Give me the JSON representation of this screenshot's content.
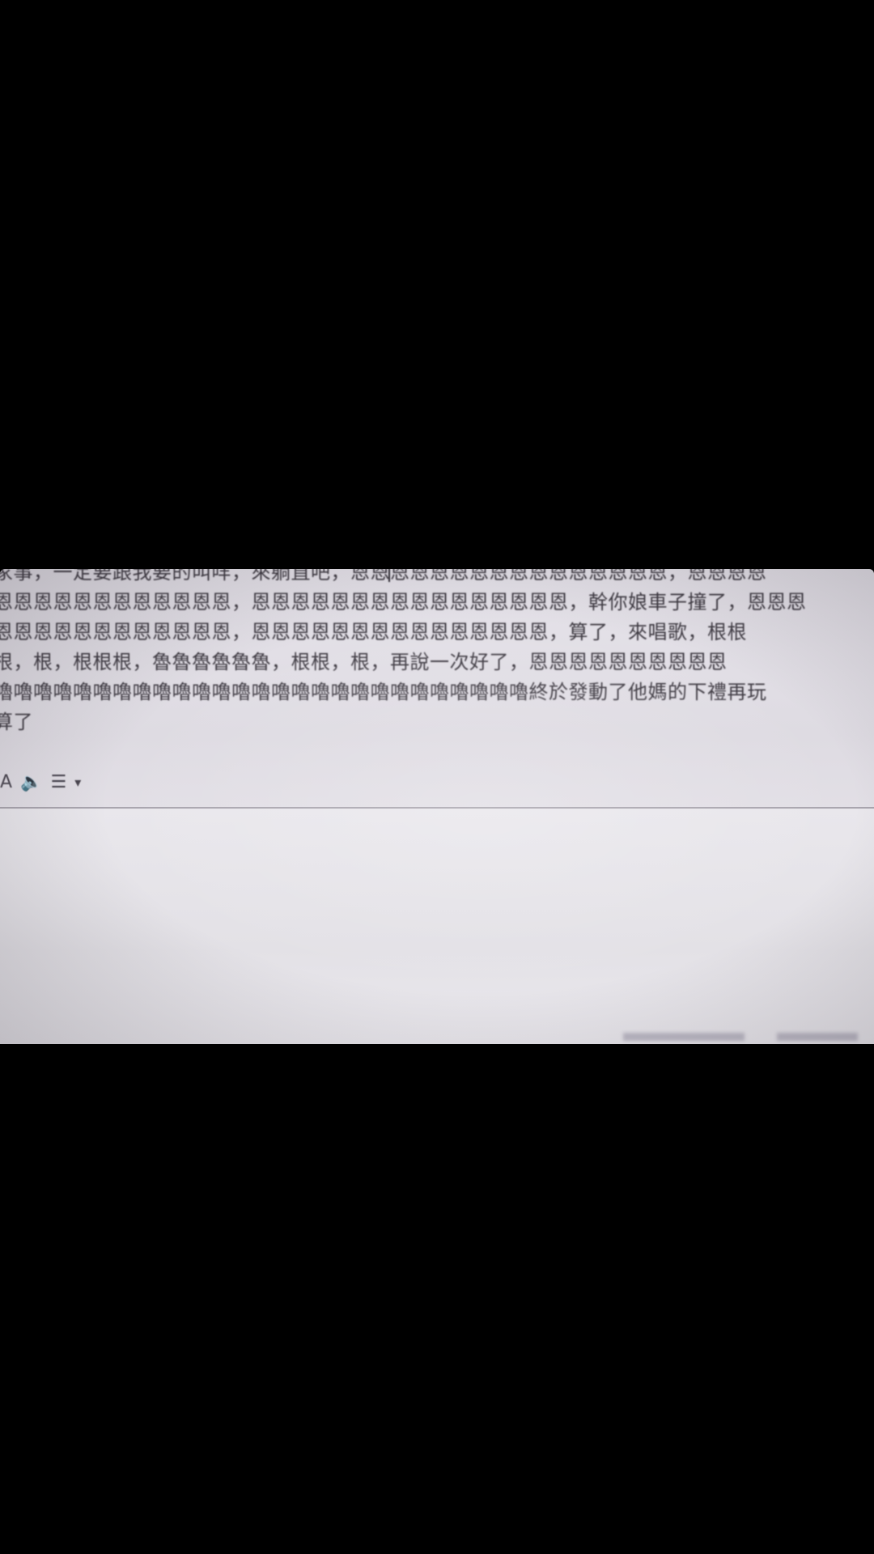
{
  "document": {
    "lines": [
      "家事，一定要跟我要的叫咩，來躺直吧，恩恩恩恩恩恩恩恩恩恩恩恩恩恩恩恩，恩恩恩恩",
      "恩恩恩恩恩恩恩恩恩恩恩恩，恩恩恩恩恩恩恩恩恩恩恩恩恩恩恩恩，幹你娘車子撞了，恩恩恩",
      "恩恩恩恩恩恩恩恩恩恩恩恩，恩恩恩恩恩恩恩恩恩恩恩恩恩恩恩，算了，來唱歌，根根",
      "根，根，根根根，魯魯魯魯魯魯，根根，根，再說一次好了，恩恩恩恩恩恩恩恩恩恩",
      "嚕嚕嚕嚕嚕嚕嚕嚕嚕嚕嚕嚕嚕嚕嚕嚕嚕嚕嚕嚕嚕嚕嚕嚕嚕嚕嚕終於發動了他媽的下禮再玩",
      "算了"
    ]
  },
  "toolbar": {
    "left_glyph": "A",
    "speaker_icon": "speaker-icon",
    "list_icon": "bullet-list-icon",
    "dropdown_icon": "chevron-down-icon",
    "speaker_symbol": "🔈",
    "list_symbol": "☰",
    "dropdown_symbol": "▾"
  },
  "colors": {
    "background": "#000000",
    "paper": "#e6e3ea",
    "text": "#3e3a42"
  }
}
